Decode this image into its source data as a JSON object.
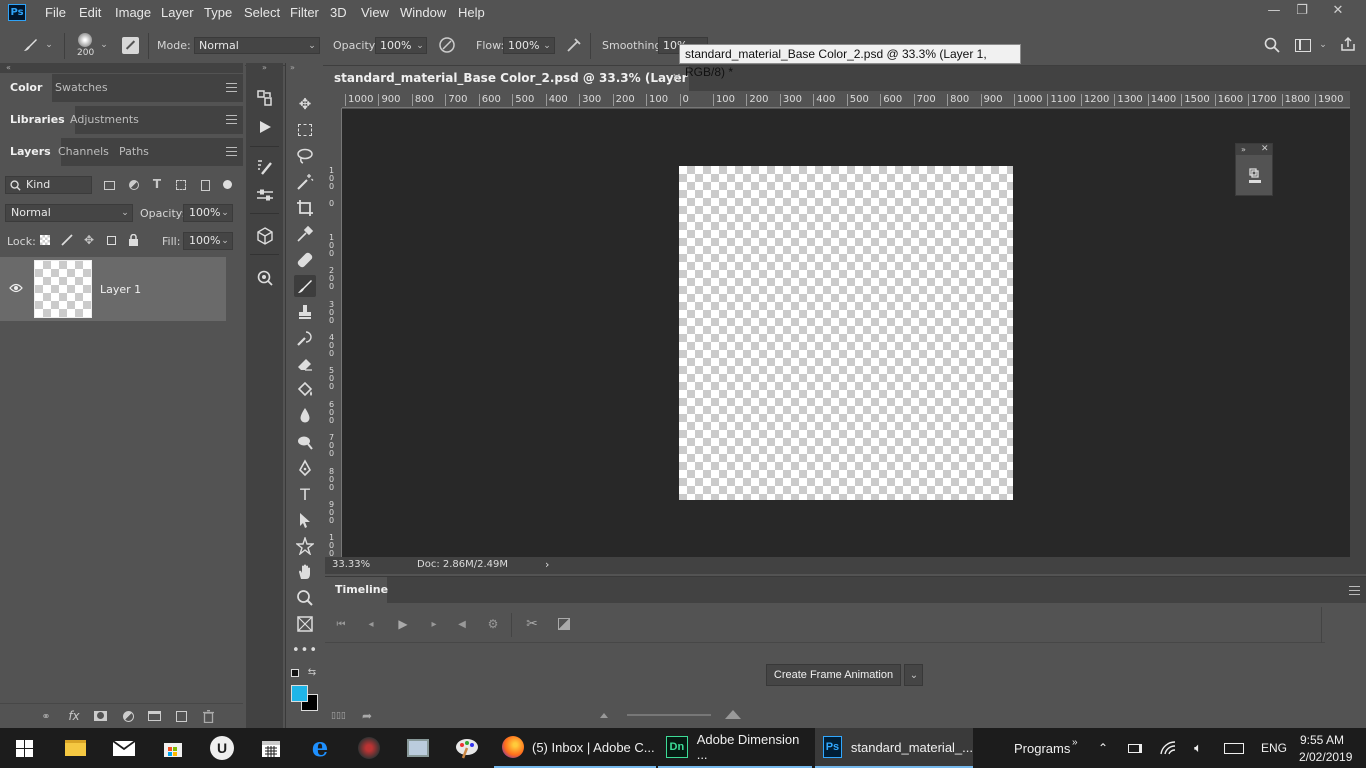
{
  "app": {
    "logo": "Ps"
  },
  "menu": [
    "File",
    "Edit",
    "Image",
    "Layer",
    "Type",
    "Select",
    "Filter",
    "3D",
    "View",
    "Window",
    "Help"
  ],
  "window_controls": {
    "minimize": "—",
    "restore": "❐",
    "close": "✕"
  },
  "options": {
    "brush_size": "200",
    "mode_label": "Mode:",
    "mode_value": "Normal",
    "opacity_label": "Opacity:",
    "opacity_value": "100%",
    "flow_label": "Flow:",
    "flow_value": "100%",
    "smoothing_label": "Smoothing:",
    "smoothing_value": "10%"
  },
  "tooltip": "standard_material_Base Color_2.psd @ 33.3% (Layer 1, RGB/8) *",
  "panels": {
    "row1_tabs": [
      "Color",
      "Swatches"
    ],
    "row2_tabs": [
      "Libraries",
      "Adjustments"
    ],
    "row3_tabs": [
      "Layers",
      "Channels",
      "Paths"
    ],
    "filter_kind": "Kind",
    "blend_mode": "Normal",
    "opacity_label": "Opacity:",
    "opacity_value": "100%",
    "lock_label": "Lock:",
    "fill_label": "Fill:",
    "fill_value": "100%",
    "layer_name": "Layer 1"
  },
  "document": {
    "tab_title": "standard_material_Base Color_2.psd @ 33.3% (Layer 1, RGB/8) *",
    "zoom": "33.33%",
    "doc_info": "Doc: 2.86M/2.49M",
    "ruler_top": [
      "1000",
      "900",
      "800",
      "700",
      "600",
      "500",
      "400",
      "300",
      "200",
      "100",
      "0",
      "100",
      "200",
      "300",
      "400",
      "500",
      "600",
      "700",
      "800",
      "900",
      "1000",
      "1100",
      "1200",
      "1300",
      "1400",
      "1500",
      "1600",
      "1700",
      "1800",
      "1900"
    ],
    "ruler_left": [
      "1\n0\n0",
      "0",
      "1\n0\n0",
      "2\n0\n0",
      "3\n0\n0",
      "4\n0\n0",
      "5\n0\n0",
      "6\n0\n0",
      "7\n0\n0",
      "8\n0\n0",
      "9\n0\n0",
      "1\n0\n0\n0"
    ]
  },
  "timeline": {
    "tab": "Timeline",
    "create_button": "Create Frame Animation"
  },
  "taskbar": {
    "firefox": "(5) Inbox | Adobe C...",
    "dimension": "Adobe Dimension ...",
    "photoshop": "standard_material_...",
    "programs": "Programs",
    "lang": "ENG",
    "time": "9:55 AM",
    "date": "2/02/2019"
  },
  "colors": {
    "foreground": "#1fb5e8",
    "background": "#000000",
    "accent": "#76b9ed"
  }
}
